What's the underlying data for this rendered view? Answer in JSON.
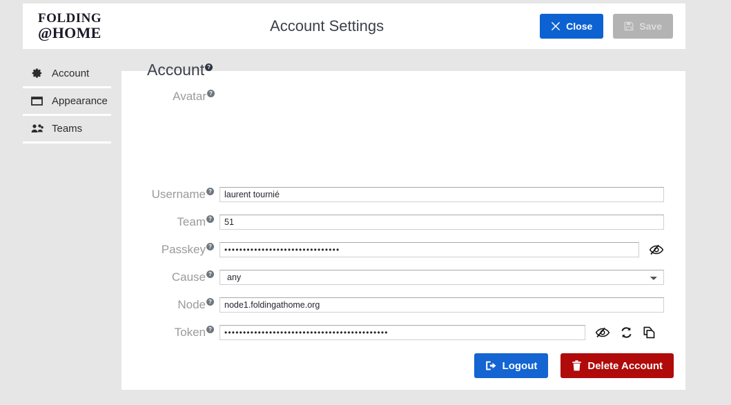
{
  "header": {
    "logo_line1": "FOLDING",
    "logo_line2": "@HOME",
    "title": "Account Settings",
    "close_label": "Close",
    "save_label": "Save",
    "close_color": "#0d62d1",
    "save_color": "#b3b3b3"
  },
  "sidebar": {
    "items": [
      {
        "label": "Account",
        "icon": "gear-icon"
      },
      {
        "label": "Appearance",
        "icon": "window-icon"
      },
      {
        "label": "Teams",
        "icon": "users-icon"
      }
    ]
  },
  "main": {
    "section_title": "Account",
    "help_glyph": "?",
    "avatar_label": "Avatar",
    "fields": [
      {
        "label": "Username",
        "value": "laurent tournié",
        "type": "text"
      },
      {
        "label": "Team",
        "value": "51",
        "type": "text"
      },
      {
        "label": "Passkey",
        "value": "•••••••••••••••••••••••••••••••",
        "type": "password"
      },
      {
        "label": "Cause",
        "value": "any",
        "type": "select",
        "options": [
          "any"
        ]
      },
      {
        "label": "Node",
        "value": "node1.foldingathome.org",
        "type": "text"
      },
      {
        "label": "Token",
        "value": "••••••••••••••••••••••••••••••••••••••••••••",
        "type": "password"
      }
    ],
    "actions": {
      "logout_label": "Logout",
      "delete_label": "Delete Account",
      "logout_color": "#1464d2",
      "delete_color": "#b00a0a"
    }
  }
}
